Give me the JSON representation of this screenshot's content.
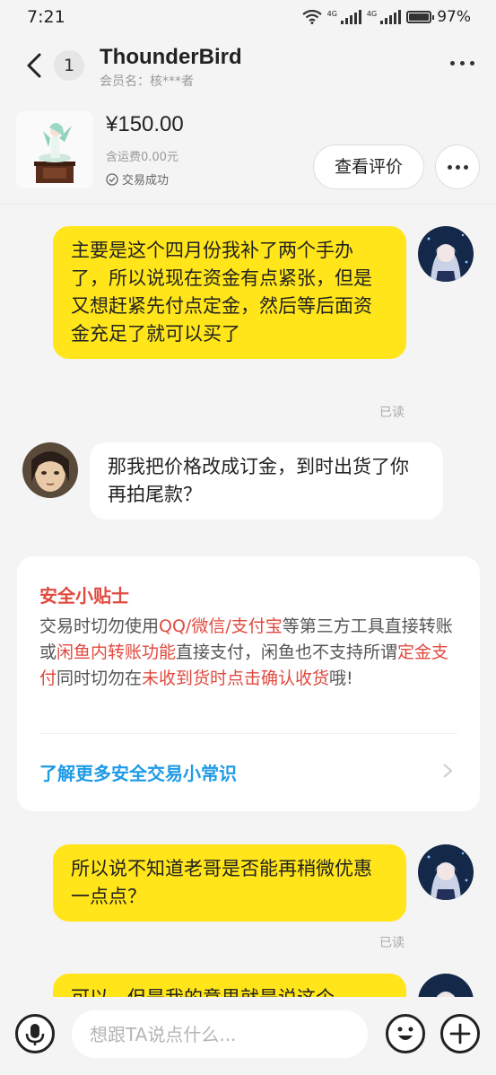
{
  "status_bar": {
    "time": "7:21",
    "network_1": "4G",
    "network_2": "4G",
    "battery_percent": "97%",
    "battery_level": 0.97
  },
  "header": {
    "unread_count": "1",
    "contact_name": "ThounderBird",
    "member_label": "会员名：核***者"
  },
  "product": {
    "price": "¥150.00",
    "shipping": "含运费0.00元",
    "trade_status": "交易成功",
    "review_button": "查看评价"
  },
  "messages": [
    {
      "from": "me",
      "text": "主要是这个四月份我补了两个手办了，所以说现在资金有点紧张，但是又想赶紧先付点定金，然后等后面资金充足了就可以买了",
      "read": "已读"
    },
    {
      "from": "other",
      "text": "那我把价格改成订金，到时出货了你再拍尾款？"
    },
    {
      "from": "me",
      "text": "所以说不知道老哥是否能再稍微优惠一点点？",
      "read": "已读"
    },
    {
      "from": "me",
      "text": "可以，但是我的意思就是说这个"
    }
  ],
  "safety_tip": {
    "title": "安全小贴士",
    "seg1": "交易时切勿使用",
    "hl1": "QQ/微信/支付宝",
    "seg2": "等第三方工具直接转账或",
    "hl2": "闲鱼内转账功能",
    "seg3": "直接支付，闲鱼也不支持所谓",
    "hl3": "定金支付",
    "seg4": "同时切勿在",
    "hl4": "未收到货时点击确认收货",
    "seg5": "哦!",
    "link": "了解更多安全交易小常识"
  },
  "input_bar": {
    "placeholder": "想跟TA说点什么..."
  },
  "colors": {
    "bubble_me": "#ffe51a",
    "warning": "#e04a3f",
    "link": "#1e9be6"
  },
  "icons": [
    "back-arrow-icon",
    "more-icon",
    "check-circle-icon",
    "voice-icon",
    "emoji-icon",
    "plus-icon",
    "chevron-right-icon"
  ]
}
